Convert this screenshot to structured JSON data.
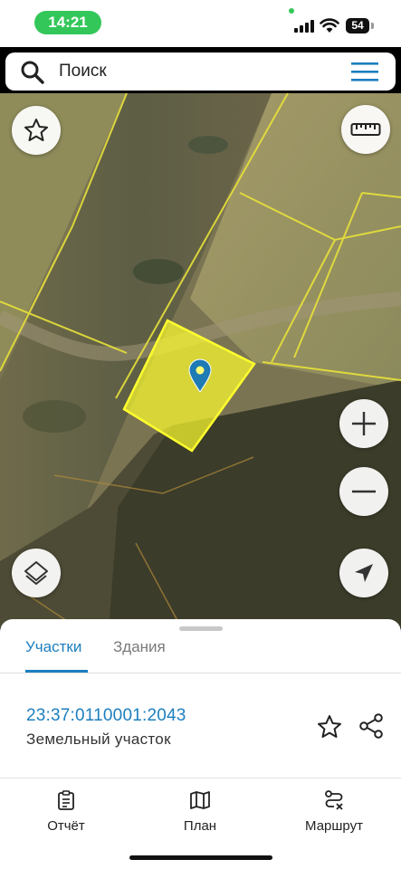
{
  "status_bar": {
    "time": "14:21",
    "battery": "54"
  },
  "search": {
    "label": "Поиск"
  },
  "map": {
    "highlight_color": "#ffff2e",
    "boundary_color": "#e8e23a",
    "marker_color": "#1e7bb4"
  },
  "sheet": {
    "tabs": [
      {
        "label": "Участки",
        "active": true
      },
      {
        "label": "Здания",
        "active": false
      }
    ],
    "parcel": {
      "number": "23:37:0110001:2043",
      "type": "Земельный участок"
    }
  },
  "bottom_nav": [
    {
      "label": "Отчёт",
      "icon": "report-icon"
    },
    {
      "label": "План",
      "icon": "map-plan-icon"
    },
    {
      "label": "Маршрут",
      "icon": "route-icon"
    }
  ],
  "colors": {
    "accent": "#1d7fbf",
    "time_pill": "#33c759"
  }
}
